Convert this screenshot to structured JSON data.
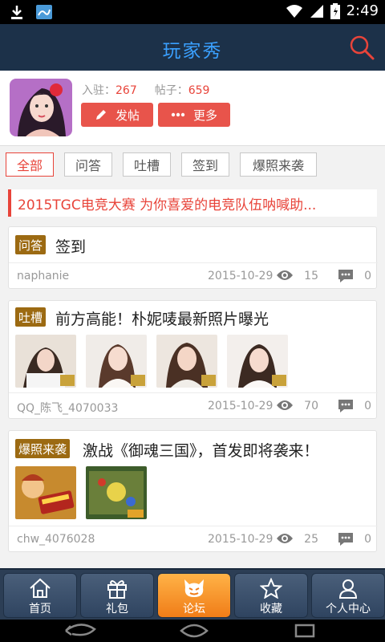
{
  "status_bar": {
    "time": "2:49"
  },
  "header": {
    "title": "玩家秀"
  },
  "profile": {
    "joined_label": "入驻：",
    "joined_value": "267",
    "posts_label": "帖子：",
    "posts_value": "659",
    "post_button": "发帖",
    "more_button": "更多"
  },
  "filters": [
    "全部",
    "问答",
    "吐槽",
    "签到",
    "爆照来袭"
  ],
  "banner": {
    "text": "2015TGC电竞大赛 为你喜爱的电竞队伍呐喊助..."
  },
  "posts": [
    {
      "tag": "问答",
      "title": "签到",
      "author": "naphanie",
      "date": "2015-10-29",
      "views": "15",
      "comments": "0"
    },
    {
      "tag": "吐槽",
      "title": "前方高能！朴妮唛最新照片曝光",
      "author": "QQ_陈飞_4070033",
      "date": "2015-10-29",
      "views": "70",
      "comments": "0"
    },
    {
      "tag": "爆照来袭",
      "title": "激战《御魂三国》，首发即将袭来！",
      "author": "chw_4076028",
      "date": "2015-10-29",
      "views": "25",
      "comments": "0"
    }
  ],
  "bottom_nav": [
    "首页",
    "礼包",
    "论坛",
    "收藏",
    "个人中心"
  ],
  "colors": {
    "accent": "#e8443a",
    "header_bg": "#1c3149",
    "title_blue": "#3aa0ff",
    "tag_brown": "#9c6a12"
  }
}
